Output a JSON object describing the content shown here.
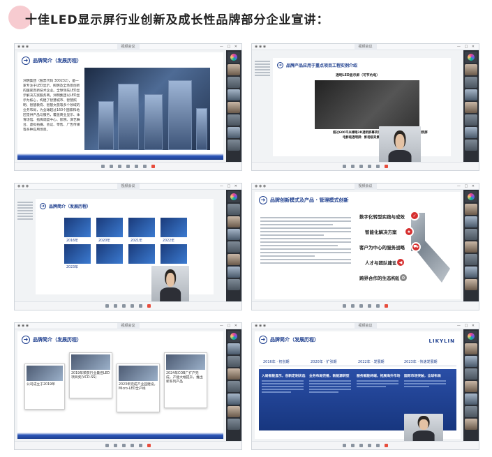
{
  "header": {
    "title": "十佳LED显示屏行业创新及成长性品牌部分企业宣讲："
  },
  "shots": [
    {
      "window_title": "视频会议",
      "slide_title": "品牌简介（发展历程）",
      "body": "洲明集团（股票代码 300232），是一家专注于LED显示、照明及全场景创新的国家高新技术企业。全球领先LED显示解决方案服务商。洲明集团以LED显示为核心，构建了智慧城市、智慧照明、智慧教育、智慧文旅等多个领域的业务布局，为全球超过160个国家和地区提供产品与服务，覆盖商业显示、体育场馆、指挥调度中心、影院、演艺舞台、虚拟拍摄、会议、零售、广告传媒等多种应用场景。"
    },
    {
      "window_title": "视频会议",
      "slide_title": "品牌产品应用于重点项目工程实例介绍",
      "caption_top": "透明LED显示屏（可节约电）",
      "caption_bottom": "超过600平米裸眼3D透明屏幕项目，24000+平方米，电影级透明屏",
      "caption_bottom2": "电影级透明屏：影视级背景画质"
    },
    {
      "window_title": "视频会议",
      "slide_title": "品牌简介（发展历程）",
      "years": [
        "2016年",
        "2020年",
        "2021年",
        "2022年",
        "2023年"
      ]
    },
    {
      "window_title": "视频会议",
      "slide_title": "品牌创新模式及产品 · 管理模式创新",
      "items": [
        {
          "title": "数字化转型实践与成效",
          "icon": "check-icon"
        },
        {
          "title": "智能化解决方案",
          "icon": "star-icon"
        },
        {
          "title": "客户为中心的服务战略",
          "icon": "cart-icon"
        },
        {
          "title": "人才与团队建设",
          "icon": "megaphone-icon"
        },
        {
          "title": "跨界合作的生态构建",
          "icon": "gear-icon"
        }
      ]
    },
    {
      "window_title": "视频会议",
      "slide_title": "品牌简介（发展历程）",
      "cards": [
        "公司成立于2019年",
        "2019年荣获行业最佳LED项目奖(VCD-SS)",
        "2023年完成产业园建设，Micro-LED全产线",
        "2024年COB厂扩产完成，产能大幅提升，推出新系列产品"
      ]
    },
    {
      "window_title": "视频会议",
      "slide_title": "品牌简介（发展历程）",
      "brand": "LIKYLIN",
      "phases": [
        {
          "year": "2016年 · 初创期",
          "head": "入局智能显示，创新定制优选"
        },
        {
          "year": "2020年 · 扩张期",
          "head": "业务布局完善，新能源转型"
        },
        {
          "year": "2022年 · 发展期",
          "head": "服务赋能终端，拓展海外市场"
        },
        {
          "year": "2023年 · 快速发展期",
          "head": "国际市场突破，全球布局"
        }
      ]
    }
  ]
}
